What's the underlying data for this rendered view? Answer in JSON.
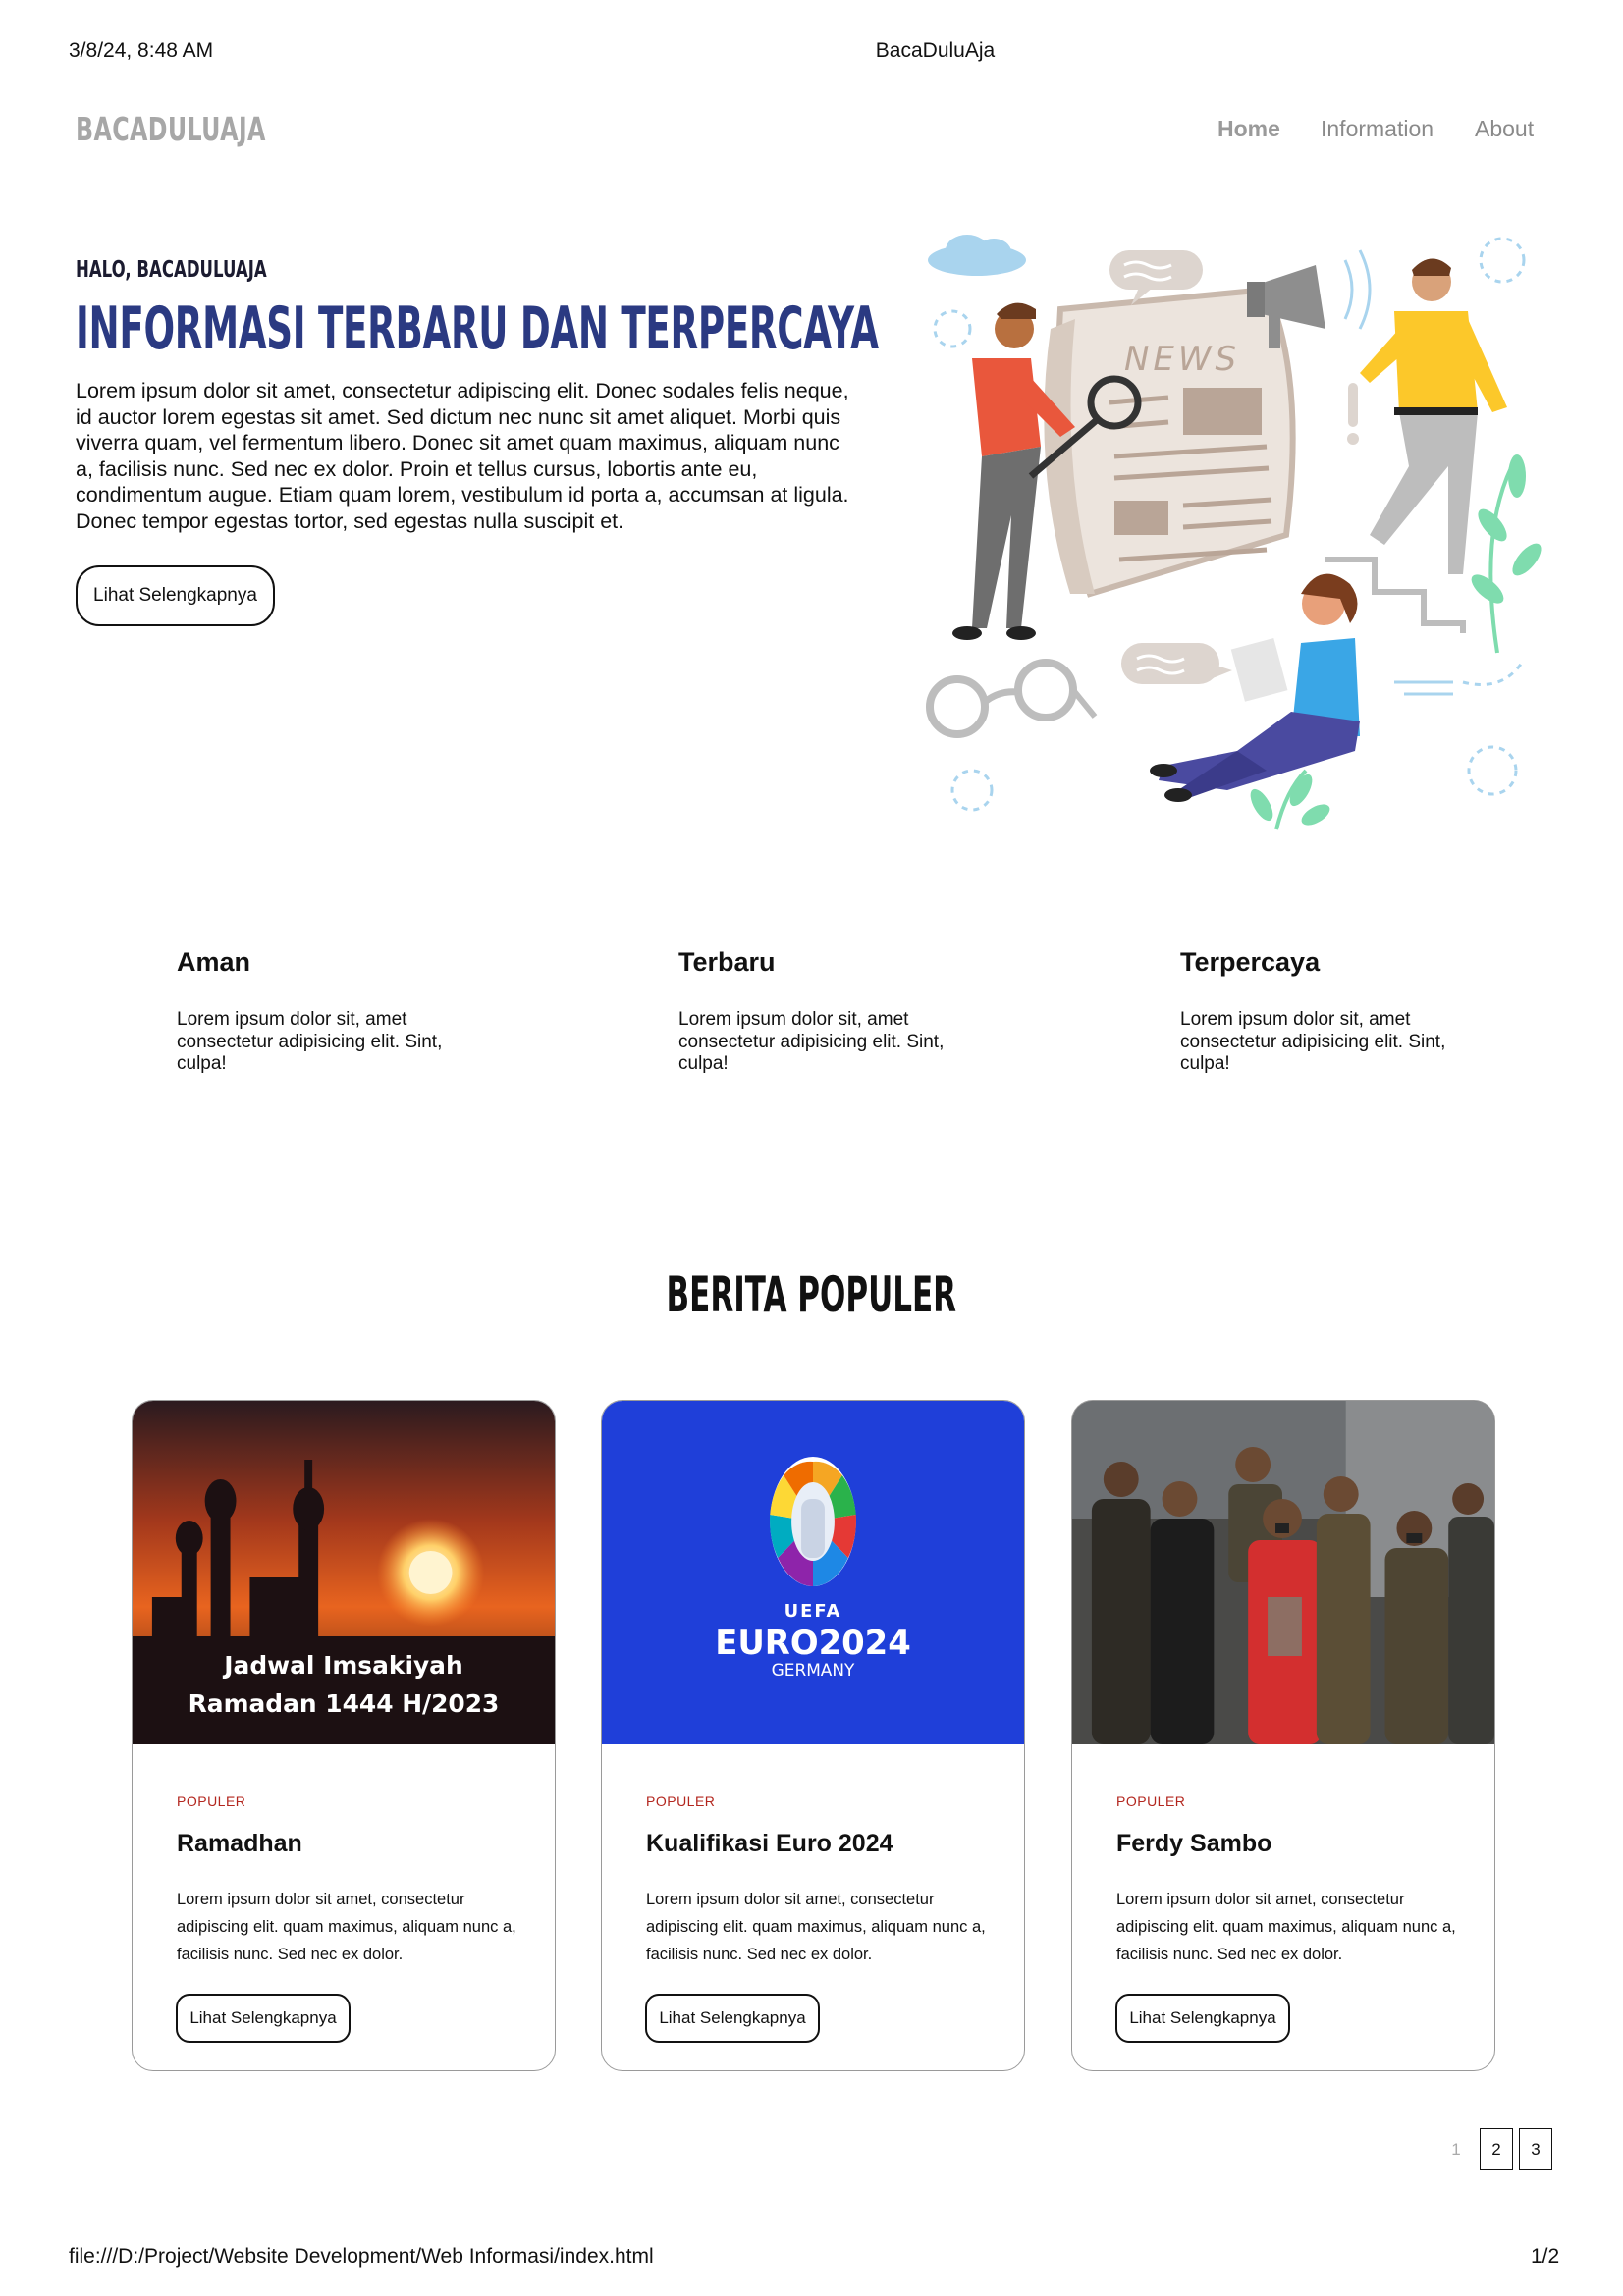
{
  "print_header": {
    "datetime": "3/8/24, 8:48 AM",
    "page_title": "BacaDuluAja"
  },
  "print_footer": {
    "path": "file:///D:/Project/Website Development/Web Informasi/index.html",
    "page_num": "1/2"
  },
  "navbar": {
    "brand": "BACADULUAJA",
    "items": [
      {
        "label": "Home"
      },
      {
        "label": "Information"
      },
      {
        "label": "About"
      }
    ]
  },
  "hero": {
    "subtitle": "HALO, BACADULUAJA",
    "title": "INFORMASI TERBARU DAN TERPERCAYA",
    "text": "Lorem ipsum dolor sit amet, consectetur adipiscing elit. Donec sodales felis neque, id auctor lorem egestas sit amet. Sed dictum nec nunc sit amet aliquet. Morbi quis viverra quam, vel fermentum libero. Donec sit amet quam maximus, aliquam nunc a, facilisis nunc. Sed nec ex dolor. Proin et tellus cursus, lobortis ante eu, condimentum augue. Etiam quam lorem, vestibulum id porta a, accumsan at ligula. Donec tempor egestas tortor, sed egestas nulla suscipit et.",
    "button": "Lihat Selengkapnya",
    "illustration_text": "NEWS"
  },
  "features": [
    {
      "title": "Aman",
      "text": "Lorem ipsum dolor sit, amet consectetur adipisicing elit. Sint, culpa!"
    },
    {
      "title": "Terbaru",
      "text": "Lorem ipsum dolor sit, amet consectetur adipisicing elit. Sint, culpa!"
    },
    {
      "title": "Terpercaya",
      "text": "Lorem ipsum dolor sit, amet consectetur adipisicing elit. Sint, culpa!"
    }
  ],
  "popular": {
    "title": "BERITA POPULER",
    "cards": [
      {
        "tag": "POPULER",
        "title": "Ramadhan",
        "text": "Lorem ipsum dolor sit amet, consectetur adipiscing elit. quam maximus, aliquam nunc a, facilisis nunc. Sed nec ex dolor.",
        "button": "Lihat Selengkapnya",
        "image_caption_1": "Jadwal Imsakiyah",
        "image_caption_2": "Ramadan 1444 H/2023"
      },
      {
        "tag": "POPULER",
        "title": "Kualifikasi Euro 2024",
        "text": "Lorem ipsum dolor sit amet, consectetur adipiscing elit. quam maximus, aliquam nunc a, facilisis nunc. Sed nec ex dolor.",
        "button": "Lihat Selengkapnya",
        "image_logo_1": "UEFA",
        "image_logo_2": "EURO2024",
        "image_logo_3": "GERMANY"
      },
      {
        "tag": "POPULER",
        "title": "Ferdy Sambo",
        "text": "Lorem ipsum dolor sit amet, consectetur adipiscing elit. quam maximus, aliquam nunc a, facilisis nunc. Sed nec ex dolor.",
        "button": "Lihat Selengkapnya"
      }
    ]
  },
  "pagination": {
    "pages": [
      "1",
      "2",
      "3"
    ],
    "current": "1"
  },
  "colors": {
    "brand_gray": "#a7a7a7",
    "title_blue": "#2b3a82",
    "tag_red": "#b3261e",
    "euro_blue": "#1f3fd9"
  }
}
